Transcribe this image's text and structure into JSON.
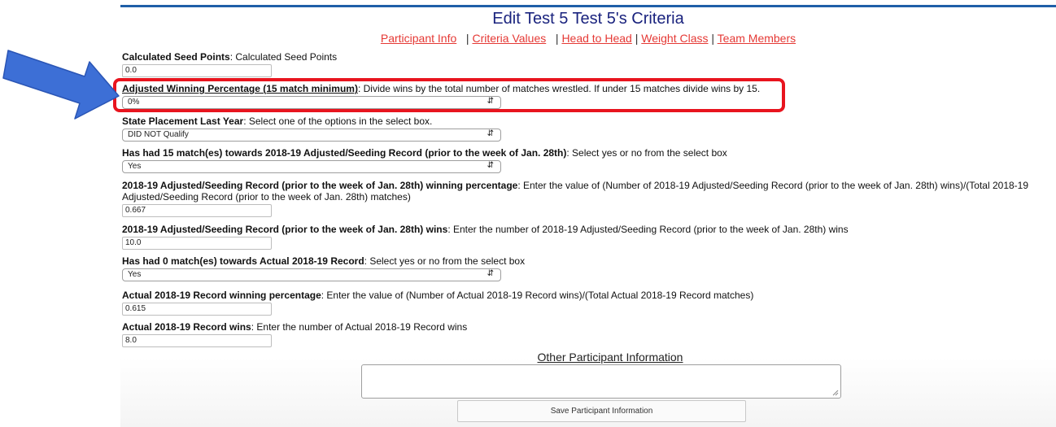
{
  "title": "Edit Test 5 Test 5's Criteria",
  "nav": {
    "participant_info": "Participant Info",
    "criteria_values": "Criteria Values",
    "head_to_head": "Head to Head",
    "weight_class": "Weight Class",
    "team_members": "Team Members",
    "sep": "|"
  },
  "fields": [
    {
      "name": "Calculated Seed Points",
      "desc": ": Calculated Seed Points",
      "value": "0.0"
    },
    {
      "name": "Adjusted Winning Percentage (15 match minimum)",
      "desc": ": Divide wins by the total number of matches wrestled. If under 15 matches divide wins by 15.",
      "value": "0%"
    },
    {
      "name": "State Placement Last Year",
      "desc": ": Select one of the options in the select box.",
      "value": "DID NOT Qualify"
    },
    {
      "name": "Has had 15 match(es) towards 2018-19 Adjusted/Seeding Record (prior to the week of Jan. 28th)",
      "desc": ": Select yes or no from the select box",
      "value": "Yes"
    },
    {
      "name": "2018-19 Adjusted/Seeding Record (prior to the week of Jan. 28th) winning percentage",
      "desc": ": Enter the value of (Number of 2018-19 Adjusted/Seeding Record (prior to the week of Jan. 28th) wins)/(Total 2018-19 Adjusted/Seeding Record (prior to the week of Jan. 28th) matches)",
      "value": "0.667"
    },
    {
      "name": "2018-19 Adjusted/Seeding Record (prior to the week of Jan. 28th) wins",
      "desc": ": Enter the number of 2018-19 Adjusted/Seeding Record (prior to the week of Jan. 28th) wins",
      "value": "10.0"
    },
    {
      "name": "Has had 0 match(es) towards Actual 2018-19 Record",
      "desc": ": Select yes or no from the select box",
      "value": "Yes"
    },
    {
      "name": "Actual 2018-19 Record winning percentage",
      "desc": ": Enter the value of (Number of Actual 2018-19 Record wins)/(Total Actual 2018-19 Record matches)",
      "value": "0.615"
    },
    {
      "name": "Actual 2018-19 Record wins",
      "desc": ": Enter the number of Actual 2018-19 Record wins",
      "value": "8.0"
    }
  ],
  "other_info_title": "Other Participant Information",
  "save_label": "Save Participant Information",
  "colors": {
    "highlight": "#e8141e",
    "arrow": "#3d6fd6",
    "link": "#e53935",
    "title": "#1a237e"
  }
}
